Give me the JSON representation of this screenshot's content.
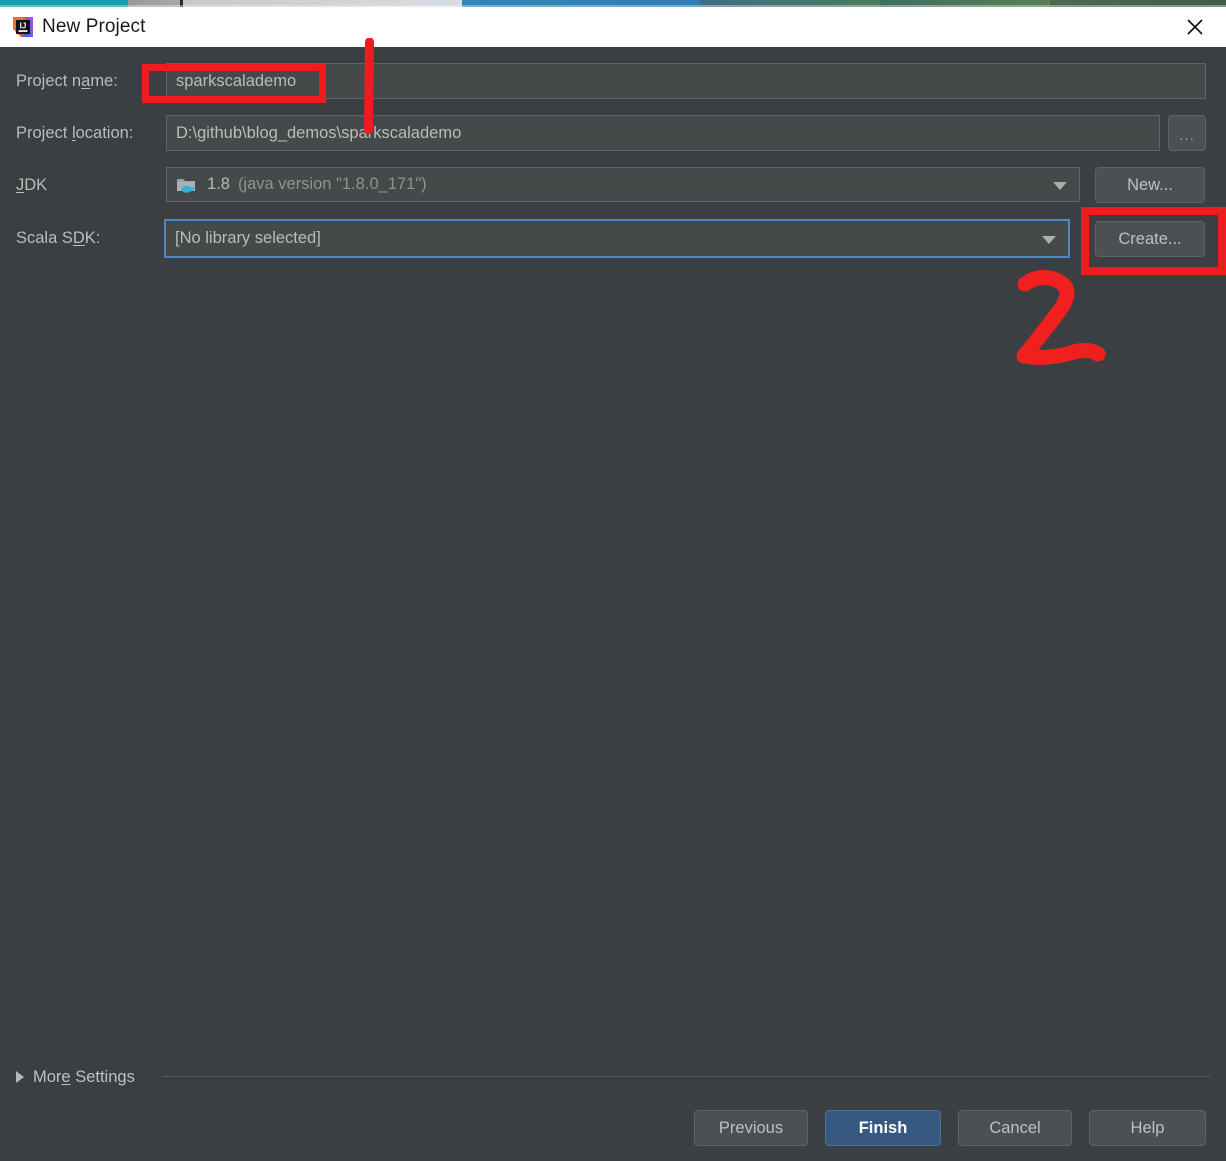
{
  "window": {
    "title": "New Project",
    "app_icon": "intellij-idea-logo",
    "close_icon": "close-icon"
  },
  "form": {
    "project_name": {
      "label_pre": "Project n",
      "label_mnemonic": "a",
      "label_post": "me:",
      "label_full": "Project name:",
      "value": "sparkscalademo"
    },
    "project_location": {
      "label_pre": "Project ",
      "label_mnemonic": "l",
      "label_post": "ocation:",
      "label_full": "Project location:",
      "value": "D:\\github\\blog_demos\\sparkscalademo",
      "browse_label": "...",
      "browse_icon": "ellipsis-icon"
    },
    "jdk": {
      "label_pre": "",
      "label_mnemonic": "J",
      "label_post": "DK",
      "label_full": "JDK",
      "value_name": "1.8",
      "value_detail": "(java version \"1.8.0_171\")",
      "icon": "jdk-folder-java-icon",
      "dropdown_icon": "chevron-down-icon",
      "new_button": "New..."
    },
    "scala_sdk": {
      "label_pre": "Scala S",
      "label_mnemonic": "D",
      "label_post": "K:",
      "label_full": "Scala SDK:",
      "value": "[No library selected]",
      "dropdown_icon": "chevron-down-icon",
      "create_button": "Create...",
      "focused": true
    }
  },
  "more_settings": {
    "label_pre": "Mor",
    "label_mnemonic": "e",
    "label_post": " Settings",
    "label_full": "More Settings",
    "expand_icon": "triangle-right-icon",
    "expanded": false
  },
  "footer": {
    "buttons": [
      {
        "label": "Previous",
        "primary": false
      },
      {
        "label": "Finish",
        "primary": true
      },
      {
        "label": "Cancel",
        "primary": false
      },
      {
        "label": "Help",
        "primary": false
      }
    ]
  },
  "annotations": {
    "color": "#ee1c20",
    "marks": [
      {
        "name": "highlight-project-name",
        "type": "rectangle"
      },
      {
        "name": "step-one-stroke",
        "type": "stroke",
        "text": "1"
      },
      {
        "name": "highlight-create-button",
        "type": "rectangle"
      },
      {
        "name": "step-two-digit",
        "type": "handwritten",
        "text": "2"
      }
    ]
  },
  "theme": {
    "dialog_bg": "#3c3f41",
    "field_bg": "#45494a",
    "field_border": "#5e6366",
    "text": "#bdc0c1",
    "label_text": "#bbbbbb",
    "focus_blue": "#4a88c7",
    "primary_button": "#365880",
    "titlebar_bg": "#ffffff",
    "titlebar_text": "#1a1a1a",
    "annotation_red": "#ee1c20"
  }
}
